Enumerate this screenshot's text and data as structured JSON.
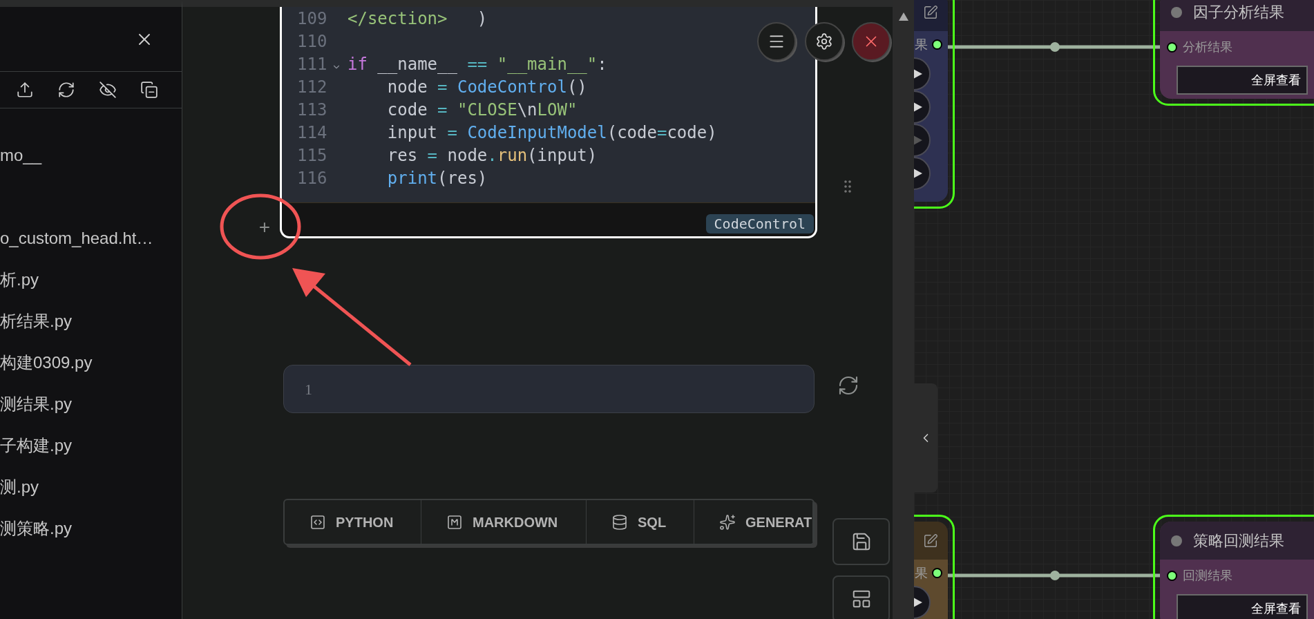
{
  "sidebar": {
    "files": [
      {
        "name": "mo__",
        "kind": "folder"
      },
      {
        "name": "o_custom_head.ht…",
        "kind": "file"
      },
      {
        "name": "析.py",
        "kind": "file"
      },
      {
        "name": "析结果.py",
        "kind": "file"
      },
      {
        "name": "构建0309.py",
        "kind": "file"
      },
      {
        "name": "测结果.py",
        "kind": "file"
      },
      {
        "name": "子构建.py",
        "kind": "file"
      },
      {
        "name": "测.py",
        "kind": "file"
      },
      {
        "name": "测策略.py",
        "kind": "file"
      }
    ]
  },
  "notebook": {
    "code_cell": {
      "lines": [
        {
          "number": "109",
          "fold": false,
          "tokens": [
            {
              "kind": "tag",
              "s": "</section>"
            },
            {
              "kind": "plain",
              "s": "   )"
            }
          ]
        },
        {
          "number": "110",
          "fold": false
        },
        {
          "number": "111",
          "fold": true,
          "tokens": [
            {
              "kind": "kw",
              "s": "if"
            },
            {
              "kind": "plain",
              "s": " __name__ "
            },
            {
              "kind": "op",
              "s": "=="
            },
            {
              "kind": "str",
              "s": " \"__main__\""
            },
            {
              "kind": "plain",
              "s": ":"
            }
          ]
        },
        {
          "number": "112",
          "fold": false,
          "tokens": [
            {
              "kind": "plain",
              "s": "    node "
            },
            {
              "kind": "op",
              "s": "="
            },
            {
              "kind": "func",
              "s": " CodeControl"
            },
            {
              "kind": "plain",
              "s": "()"
            }
          ]
        },
        {
          "number": "113",
          "fold": false,
          "tokens": [
            {
              "kind": "plain",
              "s": "    code "
            },
            {
              "kind": "op",
              "s": "="
            },
            {
              "kind": "str",
              "s": " \"CLOSE"
            },
            {
              "kind": "plain",
              "s": "\\n"
            },
            {
              "kind": "str",
              "s": "LOW\""
            }
          ]
        },
        {
          "number": "114",
          "fold": false,
          "tokens": [
            {
              "kind": "plain",
              "s": "    input "
            },
            {
              "kind": "op",
              "s": "="
            },
            {
              "kind": "func",
              "s": " CodeInputModel"
            },
            {
              "kind": "plain",
              "s": "(code"
            },
            {
              "kind": "op",
              "s": "="
            },
            {
              "kind": "plain",
              "s": "code)"
            }
          ]
        },
        {
          "number": "115",
          "fold": false,
          "tokens": [
            {
              "kind": "plain",
              "s": "    res "
            },
            {
              "kind": "op",
              "s": "="
            },
            {
              "kind": "plain",
              "s": " node"
            },
            {
              "kind": "op",
              "s": "."
            },
            {
              "kind": "method",
              "s": "run"
            },
            {
              "kind": "plain",
              "s": "(input)"
            }
          ]
        },
        {
          "number": "116",
          "fold": false,
          "tokens": [
            {
              "kind": "func",
              "s": "    print"
            },
            {
              "kind": "plain",
              "s": "(res)"
            }
          ]
        }
      ],
      "badge": "CodeControl"
    },
    "add_cell": "+",
    "input_cell": {
      "line_number": "1"
    },
    "cell_types": [
      {
        "label": "PYTHON",
        "kind": "python"
      },
      {
        "label": "MARKDOWN",
        "kind": "markdown"
      },
      {
        "label": "SQL",
        "kind": "sql"
      },
      {
        "label": "GENERAT",
        "kind": "generate"
      }
    ]
  },
  "canvas": {
    "nodes": [
      {
        "kind": "source",
        "color": "#2e3152",
        "port_label": "果",
        "play_buttons": [
          {
            "disabled": false
          },
          {
            "disabled": false
          },
          {
            "disabled": true
          },
          {
            "disabled": false
          }
        ]
      },
      {
        "kind": "result",
        "title": "因子分析结果",
        "port_label": "分析结果",
        "button": "全屏查看"
      },
      {
        "kind": "source",
        "color": "#5e4a2e",
        "port_label": "果",
        "play_buttons": [
          {
            "disabled": false
          }
        ]
      },
      {
        "kind": "result",
        "title": "策略回测结果",
        "port_label": "回测结果",
        "button": "全屏查看"
      }
    ]
  }
}
